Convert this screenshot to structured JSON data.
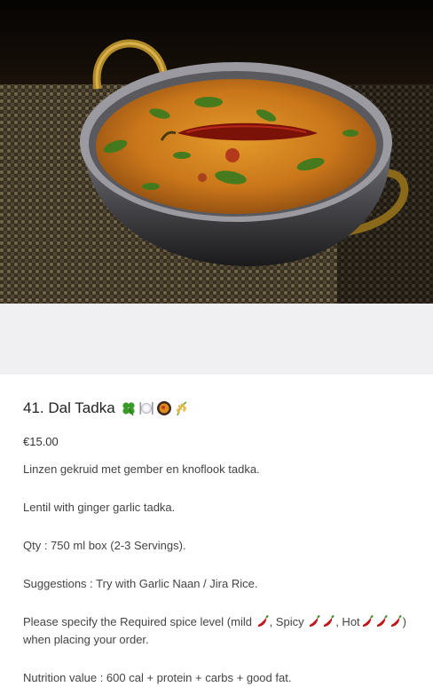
{
  "item": {
    "title": "41. Dal Tadka",
    "title_icons": [
      "clover-icon",
      "plate-cutlery-icon",
      "curry-bowl-icon",
      "rice-sheaf-icon"
    ],
    "price": "€15.00",
    "description_nl": "Linzen gekruid met gember en knoflook tadka.",
    "description_en": "Lentil with ginger garlic tadka.",
    "quantity": "Qty : 750 ml box (2-3 Servings).",
    "suggestions": "Suggestions : Try with Garlic Naan / Jira Rice.",
    "spice": {
      "prefix": "Please specify the Required spice level (mild ",
      "spicy_label": ", Spicy ",
      "hot_label": ", Hot",
      "suffix": ") when placing your order."
    },
    "nutrition": "Nutrition value : 600 cal + protein + carbs + good fat."
  },
  "colors": {
    "placeholder_band": "#f0f0f2",
    "chili_red": "#c0171b",
    "text": "#444444"
  }
}
